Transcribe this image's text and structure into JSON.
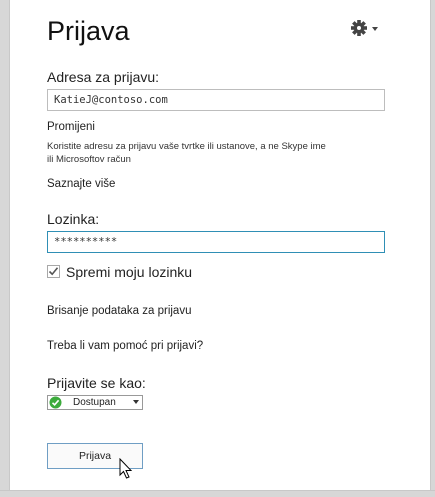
{
  "page": {
    "title": "Prijava"
  },
  "signin_address": {
    "label": "Adresa za prijavu:",
    "value": "KatieJ@contoso.com"
  },
  "change_link": "Promijeni",
  "help_text_line1": "Koristite adresu za prijavu vaše tvrtke ili ustanove, a ne Skype ime",
  "help_text_line2": "ili Microsoftov račun",
  "learn_more_link": "Saznajte više",
  "password": {
    "label": "Lozinka:",
    "value": "**********"
  },
  "save_password": {
    "label": "Spremi moju lozinku",
    "checked": true
  },
  "delete_info_link": "Brisanje podataka za prijavu",
  "help_link": "Treba li vam pomoć pri prijavi?",
  "sign_in_as": {
    "label": "Prijavite se kao:",
    "selected": "Dostupan",
    "status_color": "#3cab3c"
  },
  "sign_in_button": "Prijava",
  "icons": {
    "options": "gear-icon",
    "status": "available-status-icon",
    "pointer": "mouse-cursor-icon"
  }
}
